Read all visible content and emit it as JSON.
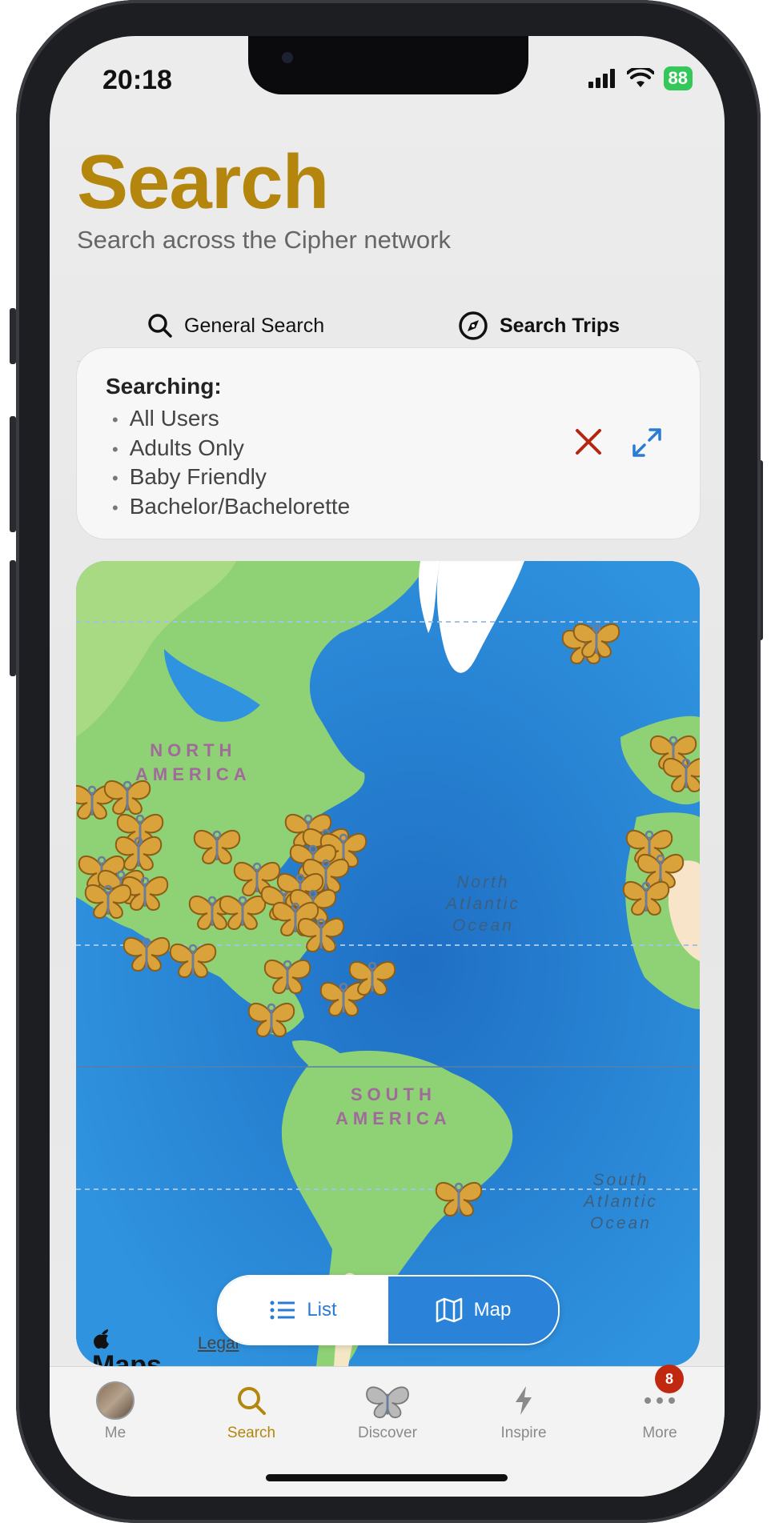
{
  "status_bar": {
    "time": "20:18",
    "battery": "88"
  },
  "header": {
    "title": "Search",
    "subtitle": "Search across the Cipher network"
  },
  "segments": {
    "general_label": "General Search",
    "trips_label": "Search Trips",
    "active": "Search Trips"
  },
  "filters": {
    "heading": "Searching:",
    "items": [
      "All Users",
      "Adults Only",
      "Baby Friendly",
      "Bachelor/Bachelorette"
    ]
  },
  "map": {
    "labels": {
      "north_america": "NORTH\nAMERICA",
      "south_america": "SOUTH\nAMERICA",
      "north_atlantic": "North\nAtlantic\nOcean",
      "south_atlantic": "South\nAtlantic\nOcean"
    },
    "attribution": "Maps",
    "legal": "Legal",
    "marker_icon": "butterfly-key-icon",
    "marker_color": "#d9a23a"
  },
  "view_toggle": {
    "list_label": "List",
    "map_label": "Map",
    "active": "Map"
  },
  "tabbar": {
    "items": [
      {
        "label": "Me",
        "icon": "avatar"
      },
      {
        "label": "Search",
        "icon": "search-icon",
        "active": true
      },
      {
        "label": "Discover",
        "icon": "butterfly-icon"
      },
      {
        "label": "Inspire",
        "icon": "bolt-icon"
      },
      {
        "label": "More",
        "icon": "ellipsis-icon",
        "badge": "8"
      }
    ]
  },
  "colors": {
    "accent": "#b5860d",
    "link": "#2a7bd6",
    "close": "#b3260f",
    "badge": "#c0290f"
  }
}
